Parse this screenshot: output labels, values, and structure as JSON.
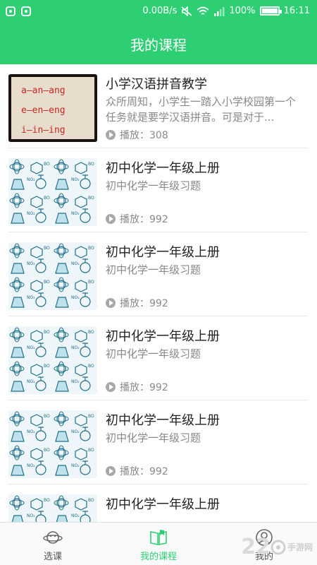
{
  "status_bar": {
    "left_icons": [
      "app-notification-icon",
      "app-notification-icon"
    ],
    "network_speed": "0.00B/s",
    "battery_percent": "100%",
    "time": "16:11",
    "icons": [
      "mute-icon",
      "wifi-icon",
      "signal-icon",
      "battery-icon"
    ]
  },
  "header": {
    "title": "我的课程"
  },
  "courses": [
    {
      "title": "小学汉语拼音教学",
      "description": "众所周知，小学生一踏入小学校园第一个任务就是要学汉语拼音。可是对于...",
      "plays_label": "播放：308",
      "thumbnail": "pinyin-board",
      "pinyin_lines": [
        "a—an—ang",
        "e—en—eng",
        "i—in—ing"
      ]
    },
    {
      "title": "初中化学一年级上册",
      "description": "初中化学一年级习题",
      "plays_label": "播放：992",
      "thumbnail": "chemistry-pattern"
    },
    {
      "title": "初中化学一年级上册",
      "description": "初中化学一年级习题",
      "plays_label": "播放：992",
      "thumbnail": "chemistry-pattern"
    },
    {
      "title": "初中化学一年级上册",
      "description": "初中化学一年级习题",
      "plays_label": "播放：992",
      "thumbnail": "chemistry-pattern"
    },
    {
      "title": "初中化学一年级上册",
      "description": "初中化学一年级习题",
      "plays_label": "播放：992",
      "thumbnail": "chemistry-pattern"
    },
    {
      "title": "初中化学一年级上册",
      "description": "",
      "plays_label": "",
      "thumbnail": "chemistry-pattern"
    }
  ],
  "bottom_nav": [
    {
      "label": "选课",
      "icon": "planet-icon",
      "active": false
    },
    {
      "label": "我的课程",
      "icon": "open-book-icon",
      "active": true
    },
    {
      "label": "我的",
      "icon": "user-icon",
      "active": false
    }
  ],
  "watermark": {
    "number": "22",
    "text": "手游网"
  },
  "colors": {
    "brand_green": "#2ecf73",
    "text_primary": "#222222",
    "text_secondary": "#888888"
  }
}
